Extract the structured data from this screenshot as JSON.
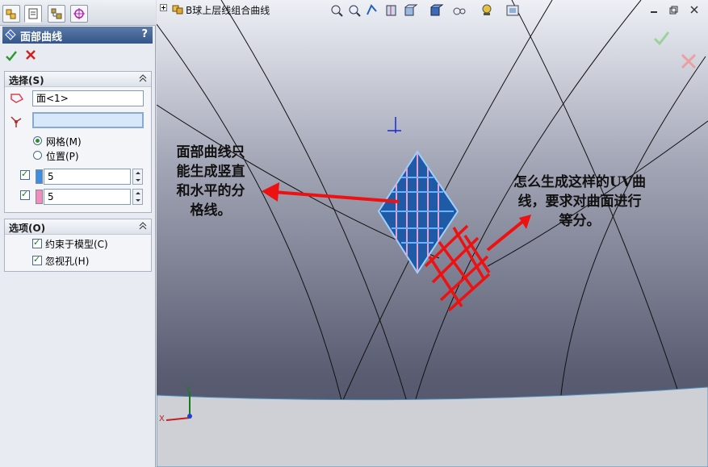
{
  "panel": {
    "tabs": [
      "feature-manager-tab",
      "property-manager-tab",
      "configuration-manager-tab",
      "dim-xpert-tab"
    ],
    "title": "面部曲线",
    "help": "?"
  },
  "selection": {
    "header": "选择(S)",
    "face_value": "面<1>",
    "vertex_value": "",
    "options": [
      {
        "label": "网格(M)",
        "selected": true
      },
      {
        "label": "位置(P)",
        "selected": false
      }
    ],
    "dir1_count": "5",
    "dir2_count": "5",
    "dir1_color": "#3a8ee6",
    "dir2_color": "#f08cc0"
  },
  "options": {
    "header": "选项(O)",
    "items": [
      {
        "label": "约束于模型(C)",
        "checked": true
      },
      {
        "label": "忽视孔(H)",
        "checked": true
      }
    ]
  },
  "viewport": {
    "breadcrumb": "B球上层线组合曲线",
    "annotation_left": "面部曲线只\n能生成竖直\n和水平的分\n格线。",
    "annotation_right": "怎么生成这样的UV曲\n线，要求对曲面进行\n等分。",
    "axis_x": "X",
    "axis_y": "Y"
  }
}
